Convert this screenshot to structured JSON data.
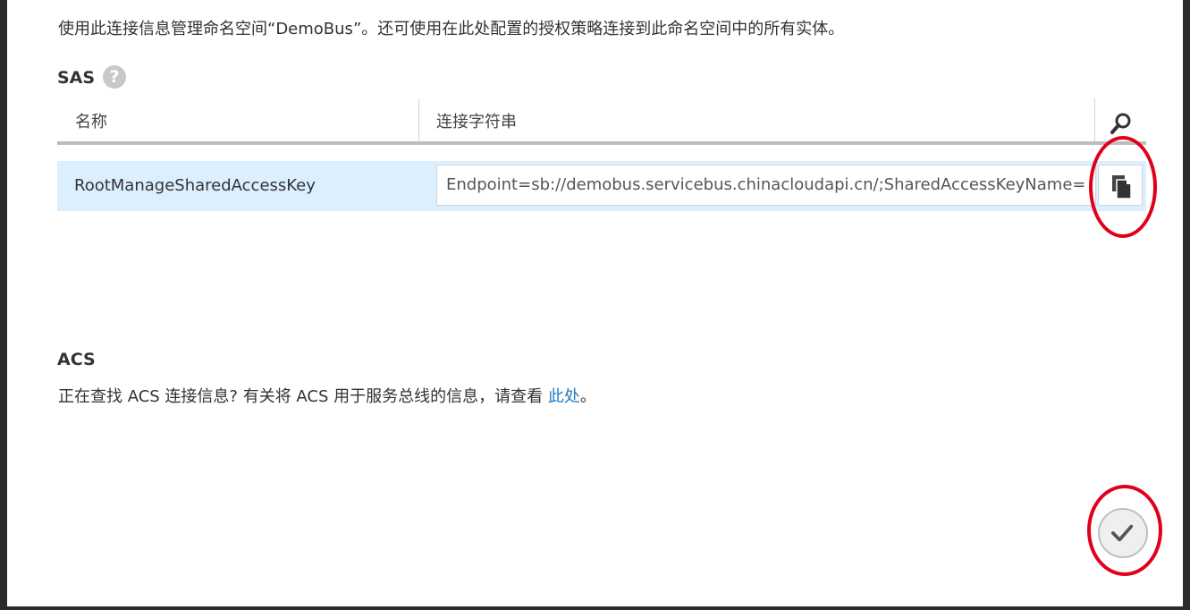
{
  "intro_text": "使用此连接信息管理命名空间“DemoBus”。还可使用在此处配置的授权策略连接到此命名空间中的所有实体。",
  "sas": {
    "title": "SAS",
    "help_glyph": "?",
    "columns": {
      "name": "名称",
      "connection_string": "连接字符串"
    },
    "rows": [
      {
        "name": "RootManageSharedAccessKey",
        "connection_string": "Endpoint=sb://demobus.servicebus.chinacloudapi.cn/;SharedAccessKeyName=Ro"
      }
    ]
  },
  "acs": {
    "title": "ACS",
    "text": "正在查找 ACS 连接信息? 有关将 ACS 用于服务总线的信息，请查看 ",
    "link_text": "此处",
    "suffix": "。"
  },
  "icons": {
    "help": "help-icon",
    "search": "search-icon",
    "copy": "copy-icon",
    "ok": "checkmark-icon"
  },
  "colors": {
    "accent_link": "#1e7bc4",
    "row_highlight": "#dcefff",
    "annotation_red": "#e0001a"
  }
}
